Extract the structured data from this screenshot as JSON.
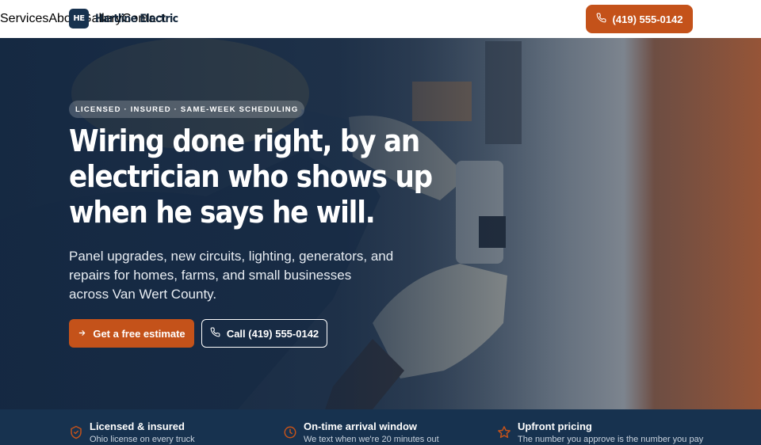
{
  "brand": {
    "mark": "HE",
    "name": "Hartline Electric"
  },
  "nav": {
    "items": [
      "Services",
      "About",
      "Gallery",
      "Contact"
    ],
    "phone": "(419) 555-0142"
  },
  "hero": {
    "badge": "LICENSED · INSURED · SAME-WEEK SCHEDULING",
    "headline": "Wiring done right, by an electrician who shows up when he says he will.",
    "subcopy": "Panel upgrades, new circuits, lighting, generators, and repairs for homes, farms, and small businesses across Van Wert County.",
    "primary_cta": "Get a free estimate",
    "secondary_cta": "Call (419) 555-0142"
  },
  "features": [
    {
      "icon": "shield-check-icon",
      "title": "Licensed & insured",
      "desc": "Ohio license on every truck"
    },
    {
      "icon": "clock-icon",
      "title": "On-time arrival window",
      "desc": "We text when we're 20 minutes out"
    },
    {
      "icon": "star-icon",
      "title": "Upfront pricing",
      "desc": "The number you approve is the number you pay"
    }
  ],
  "colors": {
    "accent": "#c4521a",
    "navy": "#17324f",
    "white": "#ffffff"
  }
}
